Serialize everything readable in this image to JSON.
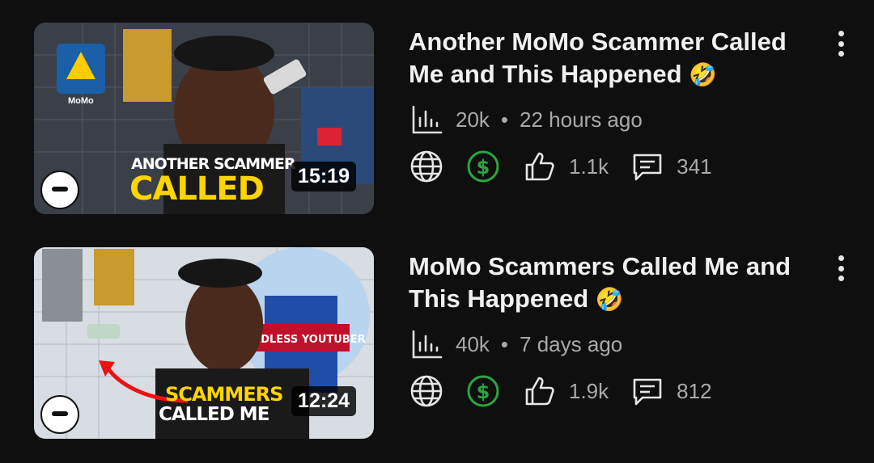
{
  "videos": [
    {
      "title": "Another MoMo Scammer Called Me and This Happened",
      "emoji": "🤣",
      "duration": "15:19",
      "thumb_line1": "ANOTHER SCAMMER",
      "thumb_line2": "CALLED",
      "views": "20k",
      "age": "22 hours ago",
      "likes": "1.1k",
      "comments": "341",
      "thumb_logo_text": "MoMo"
    },
    {
      "title": "MoMo Scammers Called Me and This Happened",
      "emoji": "🤣",
      "duration": "12:24",
      "thumb_line1": "SCAMMERS",
      "thumb_line2": "CALLED ME",
      "thumb_sign": "HEADLESS YOUTUBER",
      "views": "40k",
      "age": "7 days ago",
      "likes": "1.9k",
      "comments": "812"
    }
  ],
  "separator": "•",
  "colors": {
    "monetized": "#2ba640",
    "text_secondary": "#aaaaaa",
    "accent_yellow": "#ffd400"
  },
  "icons": [
    "views-chart-icon",
    "globe-icon",
    "dollar-icon",
    "thumbs-up-icon",
    "comment-icon",
    "more-vert-icon"
  ]
}
